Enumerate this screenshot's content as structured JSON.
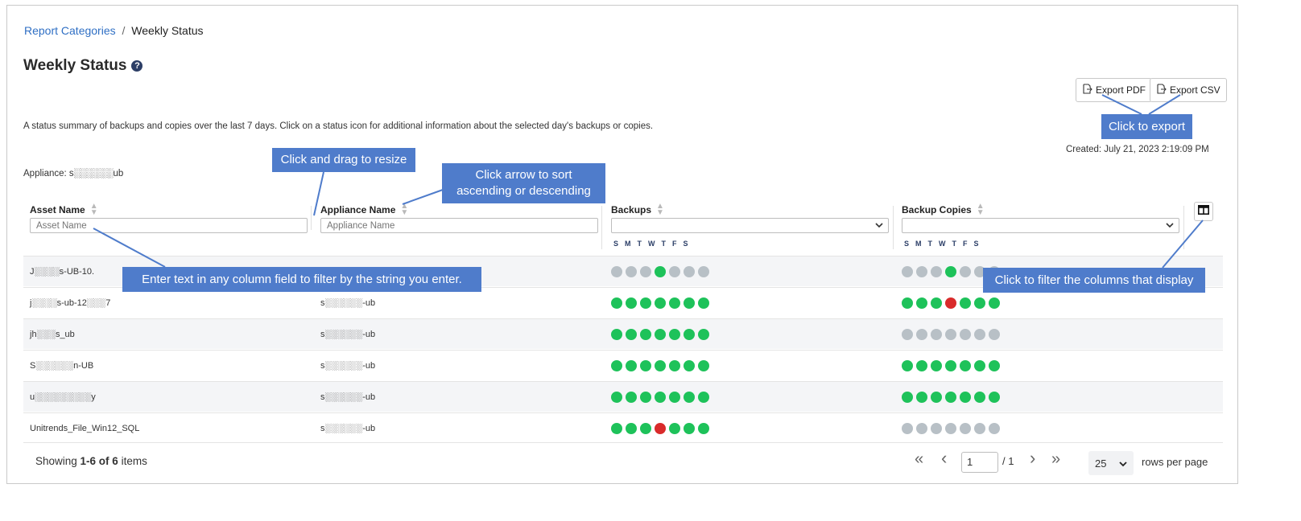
{
  "breadcrumb": {
    "parent": "Report Categories",
    "separator": "/",
    "current": "Weekly Status"
  },
  "page": {
    "title": "Weekly Status",
    "help_glyph": "?",
    "description": "A status summary of backups and copies over the last 7 days. Click on a status icon for additional information about the selected day's backups or copies.",
    "appliance_label": "Appliance: s░░░░░░ub",
    "created": "Created: July 21, 2023 2:19:09 PM"
  },
  "toolbar": {
    "export_pdf": "Export PDF",
    "export_csv": "Export CSV"
  },
  "table": {
    "columns": {
      "asset": {
        "label": "Asset Name",
        "placeholder": "Asset Name"
      },
      "appliance": {
        "label": "Appliance Name",
        "placeholder": "Appliance Name"
      },
      "backups": {
        "label": "Backups"
      },
      "copies": {
        "label": "Backup Copies"
      }
    },
    "day_letters": [
      "S",
      "M",
      "T",
      "W",
      "T",
      "F",
      "S"
    ],
    "rows": [
      {
        "asset": "J░░░░s-UB-10.",
        "appliance": "",
        "backups": [
          "gray",
          "gray",
          "gray",
          "green",
          "gray",
          "gray",
          "gray"
        ],
        "copies": [
          "gray",
          "gray",
          "gray",
          "green",
          "gray",
          "gray",
          "gray"
        ]
      },
      {
        "asset": "j░░░░s-ub-12░░░7",
        "appliance": "s░░░░░░-ub",
        "backups": [
          "green",
          "green",
          "green",
          "green",
          "green",
          "green",
          "green"
        ],
        "copies": [
          "green",
          "green",
          "green",
          "red",
          "green",
          "green",
          "green"
        ]
      },
      {
        "asset": "jh░░░s_ub",
        "appliance": "s░░░░░░-ub",
        "backups": [
          "green",
          "green",
          "green",
          "green",
          "green",
          "green",
          "green"
        ],
        "copies": [
          "gray",
          "gray",
          "gray",
          "gray",
          "gray",
          "gray",
          "gray"
        ]
      },
      {
        "asset": "S░░░░░░n-UB",
        "appliance": "s░░░░░░-ub",
        "backups": [
          "green",
          "green",
          "green",
          "green",
          "green",
          "green",
          "green"
        ],
        "copies": [
          "green",
          "green",
          "green",
          "green",
          "green",
          "green",
          "green"
        ]
      },
      {
        "asset": "u░░░░░░░░░y",
        "appliance": "s░░░░░░-ub",
        "backups": [
          "green",
          "green",
          "green",
          "green",
          "green",
          "green",
          "green"
        ],
        "copies": [
          "green",
          "green",
          "green",
          "green",
          "green",
          "green",
          "green"
        ]
      },
      {
        "asset": "Unitrends_File_Win12_SQL",
        "appliance": "s░░░░░░-ub",
        "backups": [
          "green",
          "green",
          "green",
          "red",
          "green",
          "green",
          "green"
        ],
        "copies": [
          "gray",
          "gray",
          "gray",
          "gray",
          "gray",
          "gray",
          "gray"
        ]
      }
    ]
  },
  "status_colors": {
    "green": "#1ec25a",
    "gray": "#b8c0c6",
    "red": "#d92b2b"
  },
  "footer": {
    "showing_prefix": "Showing ",
    "showing_range": "1-6 of 6",
    "showing_suffix": " items"
  },
  "pagination": {
    "first": "«",
    "prev": "‹",
    "page_value": "1",
    "total": "/ 1",
    "next": "›",
    "last": "»",
    "rows_per_page_value": "25",
    "rows_per_page_label": "rows per page"
  },
  "callouts": {
    "resize": "Click and drag to resize",
    "sort": "Click arrow to sort ascending or descending",
    "export": "Click to export",
    "filter_text": "Enter text in any column field to filter by the string you enter.",
    "filter_columns": "Click to filter the columns that display"
  },
  "icons": {
    "export": "export-icon",
    "columns": "columns-icon",
    "sort": "sort-arrows-icon",
    "dropdown": "chevron-down-icon"
  }
}
